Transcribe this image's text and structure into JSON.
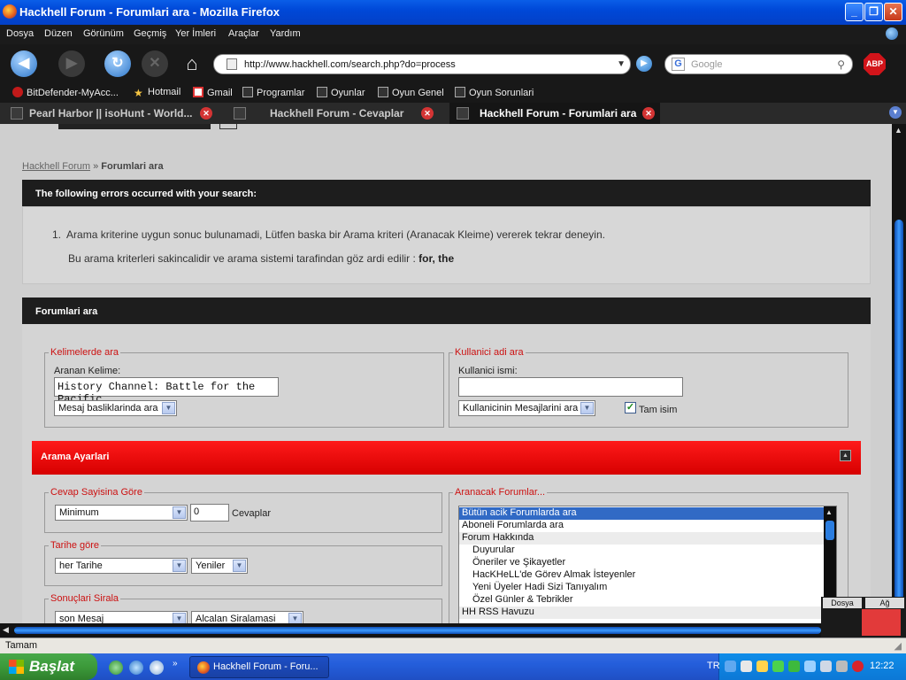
{
  "window": {
    "title": "Hackhell Forum - Forumlari ara - Mozilla Firefox",
    "controls": [
      "_",
      "❐",
      "✕"
    ]
  },
  "menubar": {
    "items": [
      "Dosya",
      "Düzen",
      "Görünüm",
      "Geçmiş",
      "Yer İmleri",
      "Araçlar",
      "Yardım"
    ]
  },
  "navbar": {
    "url": "http://www.hackhell.com/search.php?do=process",
    "search_placeholder": "Google",
    "search_engine_glyph": "G",
    "addon_label": "ABP"
  },
  "bookmarks": {
    "items": [
      "BitDefender-MyAcc...",
      "Hotmail",
      "Gmail",
      "Programlar",
      "Oyunlar",
      "Oyun Genel",
      "Oyun Sorunlari"
    ]
  },
  "tabs": {
    "items": [
      "Pearl Harbor || isoHunt - World...",
      "Hackhell Forum - Cevaplar",
      "Hackhell Forum - Forumlari ara"
    ],
    "active_index": 2
  },
  "page": {
    "breadcrumb": {
      "home": "Hackhell Forum",
      "separator": " » ",
      "current": "Forumlari ara"
    },
    "errors": {
      "title": "The following errors occurred with your search:",
      "item_number": "1.",
      "item_text": "Arama kriterine uygun sonuc bulunamadi, Lütfen baska bir Arama kriteri (Aranacak Kleime) vererek tekrar deneyin.",
      "ignored_prefix": "Bu arama kriterleri sakincalidir ve arama sistemi tarafindan göz ardi edilir : ",
      "ignored_words": "for, the"
    },
    "search": {
      "header": "Forumlari ara",
      "keywords_legend": "Kelimelerde ara",
      "keywords_label": "Aranan Kelime:",
      "keywords_value": "History Channel: Battle for the Pacific",
      "keywords_scope": "Mesaj basliklarinda ara",
      "user_legend": "Kullanici adi ara",
      "user_label": "Kullanici ismi:",
      "user_value": "",
      "user_scope": "Kullanicinin Mesajlarini ara",
      "exact_name_label": "Tam isim",
      "exact_name_checked": true
    },
    "settings": {
      "header": "Arama Ayarlari",
      "replies_legend": "Cevap Sayisina Göre",
      "replies_mode": "Minimum",
      "replies_value": "0",
      "replies_unit": "Cevaplar",
      "date_legend": "Tarihe göre",
      "date_value": "her Tarihe",
      "date_direction": "Yeniler",
      "sort_legend": "Sonuçlari Sirala",
      "sort_by": "son Mesaj",
      "sort_order": "Alcalan Siralamasi",
      "forums_legend": "Aranacak Forumlar...",
      "forums": [
        {
          "label": "Bütün acik Forumlarda ara",
          "selected": true,
          "group": false,
          "indent": false
        },
        {
          "label": "Aboneli Forumlarda ara",
          "selected": false,
          "group": false,
          "indent": false
        },
        {
          "label": "Forum Hakkında",
          "selected": false,
          "group": true,
          "indent": false
        },
        {
          "label": "Duyurular",
          "selected": false,
          "group": false,
          "indent": true
        },
        {
          "label": "Öneriler ve Şikayetler",
          "selected": false,
          "group": false,
          "indent": true
        },
        {
          "label": "HacKHeLL'de Görev Almak İsteyenler",
          "selected": false,
          "group": false,
          "indent": true
        },
        {
          "label": "Yeni Üyeler Hadi Sizi Tanıyalım",
          "selected": false,
          "group": false,
          "indent": true
        },
        {
          "label": "Özel Günler & Tebrikler",
          "selected": false,
          "group": false,
          "indent": true
        },
        {
          "label": "HH RSS Havuzu",
          "selected": false,
          "group": true,
          "indent": false
        }
      ]
    }
  },
  "overlay": {
    "left": "Dosya",
    "right": "Ağ"
  },
  "statusbar": {
    "text": "Tamam"
  },
  "taskbar": {
    "start_label": "Başlat",
    "task_label": "Hackhell Forum - Foru...",
    "language": "TR",
    "clock": "12:22"
  },
  "colors": {
    "accent_red": "#e00000",
    "legend_red": "#cc1111",
    "dark_header": "#1d1d1d",
    "selection_blue": "#316ac5"
  }
}
